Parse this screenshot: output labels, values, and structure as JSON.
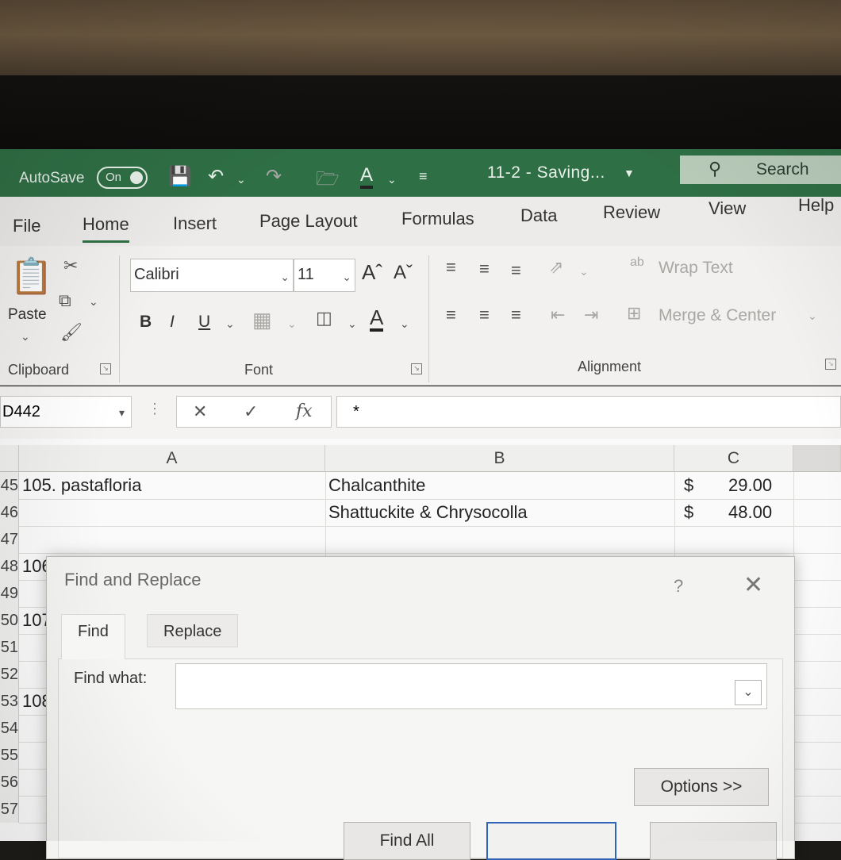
{
  "titlebar": {
    "autosave_label": "AutoSave",
    "autosave_state": "On",
    "doc_title": "11-2  -  Saving...",
    "search_label": "Search",
    "font_color_letter": "A",
    "bg_color": "#2f6f45"
  },
  "ribbon_tabs": [
    "File",
    "Home",
    "Insert",
    "Page Layout",
    "Formulas",
    "Data",
    "Review",
    "View",
    "Help"
  ],
  "ribbon": {
    "clipboard": {
      "paste_label": "Paste",
      "group_label": "Clipboard"
    },
    "font": {
      "font_name": "Calibri",
      "font_size": "11",
      "grow_label": "Aˆ",
      "shrink_label": "Aˇ",
      "bold": "B",
      "italic": "I",
      "underline": "U",
      "font_color": "A",
      "group_label": "Font"
    },
    "alignment": {
      "wrap_icon": "ab",
      "wrap_text": "Wrap Text",
      "merge_center": "Merge & Center",
      "group_label": "Alignment"
    }
  },
  "formula_bar": {
    "name_box": "D442",
    "cancel": "✕",
    "enter": "✓",
    "fx": "fx",
    "content": "*"
  },
  "grid": {
    "columns": [
      "A",
      "B",
      "C"
    ],
    "rows": [
      {
        "num": "45",
        "a": "105. pastafloria",
        "b": "Chalcanthite",
        "c_cur": "$",
        "c": "29.00"
      },
      {
        "num": "46",
        "a": "",
        "b": "Shattuckite & Chrysocolla",
        "c_cur": "$",
        "c": "48.00"
      },
      {
        "num": "47",
        "a": "",
        "b": "",
        "c_cur": "",
        "c": ""
      },
      {
        "num": "48",
        "a": "106.",
        "b": "",
        "c_cur": "",
        "c": ""
      },
      {
        "num": "49",
        "a": "",
        "b": "",
        "c_cur": "",
        "c": ""
      },
      {
        "num": "50",
        "a": "107.",
        "b": "",
        "c_cur": "",
        "c": ""
      },
      {
        "num": "51",
        "a": "",
        "b": "",
        "c_cur": "",
        "c": ""
      },
      {
        "num": "52",
        "a": "",
        "b": "",
        "c_cur": "",
        "c": ""
      },
      {
        "num": "53",
        "a": "108.",
        "b": "",
        "c_cur": "",
        "c": ""
      },
      {
        "num": "54",
        "a": "",
        "b": "",
        "c_cur": "",
        "c": ""
      },
      {
        "num": "55",
        "a": "",
        "b": "",
        "c_cur": "",
        "c": ""
      },
      {
        "num": "56",
        "a": "",
        "b": "",
        "c_cur": "",
        "c": ""
      },
      {
        "num": "57",
        "a": "",
        "b": "",
        "c_cur": "",
        "c": ""
      }
    ]
  },
  "dialog": {
    "title": "Find and Replace",
    "help": "?",
    "close": "✕",
    "tabs": [
      "Find",
      "Replace"
    ],
    "find_what_label": "Find what:",
    "find_what_value": "",
    "options_button": "Options >>",
    "find_all_button": "Find All"
  }
}
